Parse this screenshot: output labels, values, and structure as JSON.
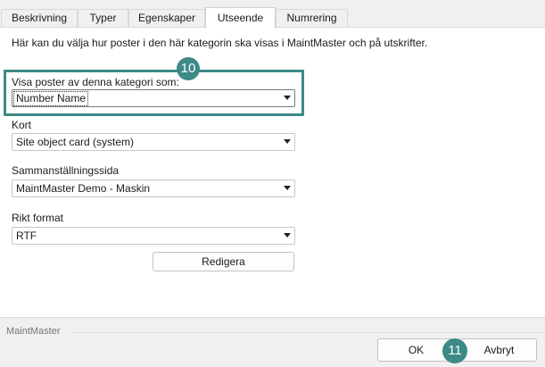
{
  "tabs": [
    {
      "label": "Beskrivning"
    },
    {
      "label": "Typer"
    },
    {
      "label": "Egenskaper"
    },
    {
      "label": "Utseende",
      "active": true
    },
    {
      "label": "Numrering"
    }
  ],
  "description": "Här kan du välja hur poster i den här kategorin ska visas i MaintMaster och på utskrifter.",
  "display_as": {
    "label": "Visa poster av denna kategori som:",
    "value": "Number Name"
  },
  "card": {
    "label": "Kort",
    "value": "Site object card (system)"
  },
  "summary_page": {
    "label": "Sammanställningssida",
    "value": "MaintMaster Demo - Maskin"
  },
  "rich_format": {
    "label": "Rikt format",
    "value": "RTF",
    "edit_label": "Redigera"
  },
  "footer": {
    "brand": "MaintMaster",
    "ok_label": "OK",
    "cancel_label": "Avbryt"
  },
  "callouts": {
    "first": "10",
    "second": "11"
  },
  "colors": {
    "callout": "#3d8a87",
    "footer_bg": "#f0f0f0"
  }
}
